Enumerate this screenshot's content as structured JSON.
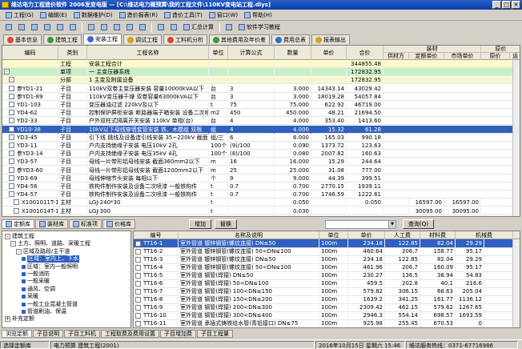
{
  "window": {
    "title": "维达电力工程造价软件 2006发变电版 — [C:\\维达电力概预算\\我的工程文件\\110KV变电站工程.dlys]",
    "min": "_",
    "max": "□",
    "close": "✕"
  },
  "menu": [
    {
      "label": "工程(G)"
    },
    {
      "label": "编辑(E)"
    },
    {
      "label": "数据维护(D)"
    },
    {
      "label": "造价报表(R)"
    },
    {
      "label": "造价工具(T)"
    },
    {
      "label": "窗口(W)"
    },
    {
      "label": "帮助(H)"
    }
  ],
  "toolbar": [
    {
      "label": "",
      "icon": "open-icon"
    },
    {
      "label": "",
      "icon": "save-icon"
    },
    {
      "label": "",
      "icon": "cut-icon"
    },
    {
      "label": "",
      "icon": "copy-icon"
    },
    {
      "label": "",
      "icon": "paste-icon"
    },
    {
      "label": "",
      "icon": "undo-icon"
    },
    {
      "label": "",
      "icon": "print-icon"
    },
    {
      "label": "",
      "icon": "find-icon"
    },
    {
      "label": "",
      "icon": "filter-icon"
    },
    {
      "label": "",
      "icon": "sort-icon"
    },
    {
      "label": "",
      "icon": "grid-icon"
    },
    {
      "label": "",
      "icon": "calc-icon"
    },
    {
      "label": "",
      "icon": "chart-icon"
    },
    {
      "label": "汇总计算",
      "icon": "sum-icon"
    },
    {
      "label": "",
      "icon": "tool-icon"
    },
    {
      "label": "软件学习教程",
      "icon": "help-icon"
    }
  ],
  "tabs": [
    {
      "label": "基本信息",
      "color": "r"
    },
    {
      "label": "建筑工程",
      "color": "g"
    },
    {
      "label": "安装工程",
      "color": "b",
      "active": true
    },
    {
      "label": "调试工程",
      "color": "y"
    },
    {
      "label": "工料机分析",
      "color": "r"
    },
    {
      "label": "其他费用及年价差",
      "color": "g"
    },
    {
      "label": "费用总表",
      "color": "b"
    },
    {
      "label": "报表输出",
      "color": "y"
    }
  ],
  "top_grid": {
    "headers": {
      "code": "编码",
      "type": "类别",
      "name": "工程名称",
      "unit": "单位",
      "formula": "计算公式",
      "qty": "数量",
      "price": "单价",
      "total": "合价",
      "mat_group": "装材",
      "supplier": "供材方",
      "def_price": "定额单价",
      "mkt_price": "市场单价",
      "ori_group": "原价",
      "ori": "原价",
      "trans": "运"
    },
    "rows": [
      {
        "kind": "proj",
        "code": "",
        "type": "工程",
        "name": "安装工程合计",
        "unit": "",
        "formula": "",
        "qty": "",
        "price": "",
        "total": "344855.48"
      },
      {
        "kind": "unit",
        "code": "",
        "type": "单项",
        "name": "一 主变压器系统",
        "unit": "",
        "formula": "",
        "qty": "",
        "price": "",
        "total": "172832.95"
      },
      {
        "kind": "part",
        "code": "",
        "type": "分部",
        "name": "1 主变及附属设备",
        "unit": "",
        "formula": "",
        "qty": "",
        "price": "",
        "total": "172832.95"
      },
      {
        "kind": "item",
        "code": "参YD1-21",
        "type": "子目",
        "name": "110kV双卷主变压器安装  容量10000kVA以下",
        "unit": "台",
        "formula": "3",
        "qty": "3.000",
        "price": "14343.14",
        "total": "43029.42"
      },
      {
        "kind": "item",
        "code": "参YD1-89",
        "type": "子目",
        "name": "110kV变压器干燥  双卷容量63000kVA以下",
        "unit": "台",
        "formula": "3",
        "qty": "3.000",
        "price": "18019.28",
        "total": "54057.84"
      },
      {
        "kind": "item",
        "code": "YD1-103",
        "type": "子目",
        "name": "变压器油过滤  220kV及以下",
        "unit": "t",
        "formula": "75",
        "qty": "75.000",
        "price": "622.92",
        "total": "46719.00"
      },
      {
        "kind": "item",
        "code": "YD4-62",
        "type": "子目",
        "name": "控制保护屏柜安装 断路器端子箱安装  设备二次喷漆",
        "unit": "m2",
        "formula": "450",
        "qty": "450.000",
        "price": "48.21",
        "total": "21694.50"
      },
      {
        "kind": "item",
        "code": "YD2-33",
        "type": "子目",
        "name": "户外双柱式隔离开关安装  110kV  单相(台)",
        "unit": "台",
        "formula": "4",
        "qty": "4.000",
        "price": "353.40",
        "total": "1413.60"
      },
      {
        "kind": "sel",
        "code": "YD10-38",
        "type": "子目",
        "name": "10kV以下母线穿墙套管安装  铁、木模组  双根",
        "unit": "组",
        "formula": "4",
        "qty": "4.000",
        "price": "15.32",
        "total": "61.28"
      },
      {
        "kind": "item",
        "code": "YD3-45",
        "type": "子目",
        "name": "引下线 跳线及设备连引线安装  35~220kV 截面",
        "unit": "组/三",
        "formula": "6",
        "qty": "6.000",
        "price": "165.03",
        "total": "990.18"
      },
      {
        "kind": "item",
        "code": "YD3-11",
        "type": "子目",
        "name": "户内支持绝缘子安装  电压10kV  2孔",
        "unit": "100个",
        "formula": "(9)/100",
        "qty": "0.090",
        "price": "1373.72",
        "total": "123.63"
      },
      {
        "kind": "item",
        "code": "参YD3-14",
        "type": "子目",
        "name": "户内支持绝缘子安装  电压35kV  4孔",
        "unit": "100个",
        "formula": "(8)/100",
        "qty": "0.080",
        "price": "2007.82",
        "total": "160.63"
      },
      {
        "kind": "item",
        "code": "YD3-57",
        "type": "子目",
        "name": "母线一片带形铝母线安装  截面360mm2以下",
        "unit": "m",
        "formula": "16",
        "qty": "16.000",
        "price": "15.29",
        "total": "244.64"
      },
      {
        "kind": "item",
        "code": "参YD3-60",
        "type": "子目",
        "name": "母线一片带形铝母线安装  截面1200mm2以下",
        "unit": "m",
        "formula": "25",
        "qty": "25.000",
        "price": "31.08",
        "total": "777.00"
      },
      {
        "kind": "item",
        "code": "YD3-69",
        "type": "子目",
        "name": "母线伸缩节头安装  每相以下",
        "unit": "个",
        "formula": "9",
        "qty": "9.000",
        "price": "44.39",
        "total": "399.51"
      },
      {
        "kind": "item",
        "code": "YD4-56",
        "type": "子目",
        "name": "铁构件制作安装及设备二次喷漆  一般铁构件",
        "unit": "t",
        "formula": "0.7",
        "qty": "0.700",
        "price": "2770.15",
        "total": "1939.11"
      },
      {
        "kind": "item",
        "code": "YD4-57",
        "type": "子目",
        "name": "铁构件制作安装及设备二次喷漆  一般铁构件",
        "unit": "t",
        "formula": "0.7",
        "qty": "0.700",
        "price": "1746.59",
        "total": "1222.61"
      },
      {
        "kind": "mat",
        "code": "X1001011T-1",
        "type": "主材",
        "name": "LGJ-240*30",
        "unit": "t",
        "formula": "",
        "qty": "0.050",
        "price": "",
        "total": "0.050",
        "supplier": "",
        "def_price": "16597.00",
        "mkt_price": "16597.00"
      },
      {
        "kind": "mat",
        "code": "X1001014T-1",
        "type": "主材",
        "name": "LGJ-300",
        "unit": "t",
        "formula": "",
        "qty": "0.030",
        "price": "",
        "total": "",
        "supplier": "",
        "def_price": "30095.00",
        "mkt_price": "30095.00"
      }
    ]
  },
  "lib_tabs": [
    {
      "label": "定额库",
      "active": true
    },
    {
      "label": "装材库"
    },
    {
      "label": "标准项"
    },
    {
      "label": "价格库"
    }
  ],
  "mid_buttons": {
    "add": "增加",
    "replace": "替换",
    "search_label": "查询(Q)"
  },
  "tree": [
    {
      "level": 0,
      "label": "建筑工程",
      "pm": "-"
    },
    {
      "level": 1,
      "label": "土方、照明、道路、采暖工程",
      "pm": "-"
    },
    {
      "level": 2,
      "label": "区域及路段/主干道",
      "pm": "-"
    },
    {
      "level": 3,
      "label": "区域：室内上、下水",
      "sel": true
    },
    {
      "level": 3,
      "label": "区域：室内一般照明"
    },
    {
      "level": 3,
      "label": "一般消防"
    },
    {
      "level": 3,
      "label": "一般采暖"
    },
    {
      "level": 3,
      "label": "通风、空调"
    },
    {
      "level": 3,
      "label": "采暖"
    },
    {
      "level": 3,
      "label": "一般工业混凝土管道"
    },
    {
      "level": 3,
      "label": "管道刷油、保温"
    },
    {
      "level": 0,
      "label": "补充定额",
      "pm": "+"
    }
  ],
  "bot_grid": {
    "headers": {
      "code": "编号",
      "name": "名称及说明",
      "unit": "单位",
      "price": "单价",
      "labor": "人工费",
      "mat": "材料费",
      "mach": "机械费"
    },
    "rows": [
      {
        "code": "TT16-1",
        "name": "室外管道  镀锌钢管(螺纹连接) DN≤50",
        "unit": "100m",
        "price": "234.18",
        "labor": "122.85",
        "mat": "82.04",
        "mach": "29.29",
        "sel": true
      },
      {
        "code": "TT16-2",
        "name": "室外管道  镀锌钢管(螺纹连接) 50<DN≤100",
        "unit": "100m",
        "price": "460.64",
        "labor": "206.7",
        "mat": "158.77",
        "mach": "95.17"
      },
      {
        "code": "TT16-3",
        "name": "室外管道  镀锌钢管(螺纹连接) DN≤50",
        "unit": "100m",
        "price": "234.18",
        "labor": "122.85",
        "mat": "82.04",
        "mach": "29.29"
      },
      {
        "code": "TT16-4",
        "name": "室外管道  镀锌钢管(螺纹连接) 50<DN≤100",
        "unit": "100m",
        "price": "461.96",
        "labor": "206.7",
        "mat": "160.09",
        "mach": "95.17"
      },
      {
        "code": "TT16-5",
        "name": "室外管道  钢管(焊接) DN≤50",
        "unit": "100m",
        "price": "230.27",
        "labor": "136.5",
        "mat": "38.94",
        "mach": "54.83"
      },
      {
        "code": "TT16-6",
        "name": "室外管道  钢管(焊接) 50<DN≤100",
        "unit": "100m",
        "price": "459.5",
        "labor": "202.8",
        "mat": "40.1",
        "mach": "216.6"
      },
      {
        "code": "TT16-7",
        "name": "室外管道  钢管(焊接) 100<DN≤150",
        "unit": "100m",
        "price": "579.82",
        "labor": "306.15",
        "mat": "68.63",
        "mach": "205.04"
      },
      {
        "code": "TT16-8",
        "name": "室外管道  钢管(焊接) 150<DN≤200",
        "unit": "100m",
        "price": "1639.2",
        "labor": "341.25",
        "mat": "161.77",
        "mach": "1136.12"
      },
      {
        "code": "TT16-9",
        "name": "室外管道  钢管(焊接) 200<DN≤300",
        "unit": "100m",
        "price": "2309.42",
        "labor": "462.15",
        "mat": "579.62",
        "mach": "1267.65"
      },
      {
        "code": "TT16-10",
        "name": "室外管道  钢管(焊接) 300<DN≤400",
        "unit": "100m",
        "price": "2946.3",
        "labor": "554.14",
        "mat": "698.57",
        "mach": "1693.59"
      },
      {
        "code": "TT16-11",
        "name": "室外管道  承插式铸铁给水管(青铅接口) DN≤75",
        "unit": "100m",
        "price": "925.98",
        "labor": "255.45",
        "mat": "670.53",
        "mach": "0"
      }
    ]
  },
  "bottom_tabs": [
    {
      "label": "浏览定额",
      "active": true
    },
    {
      "label": "子目说明"
    },
    {
      "label": "子目工料机"
    },
    {
      "label": "工程取费及费用设置"
    },
    {
      "label": "子目增加费"
    },
    {
      "label": "子目工程量"
    }
  ],
  "status": {
    "lib": "选择定额库",
    "lib_value": "电力预算 建筑工程(2001)",
    "date": "2016年10月15日 星期六 15:46",
    "hotline": "维达服务热线：0371-67716986"
  }
}
